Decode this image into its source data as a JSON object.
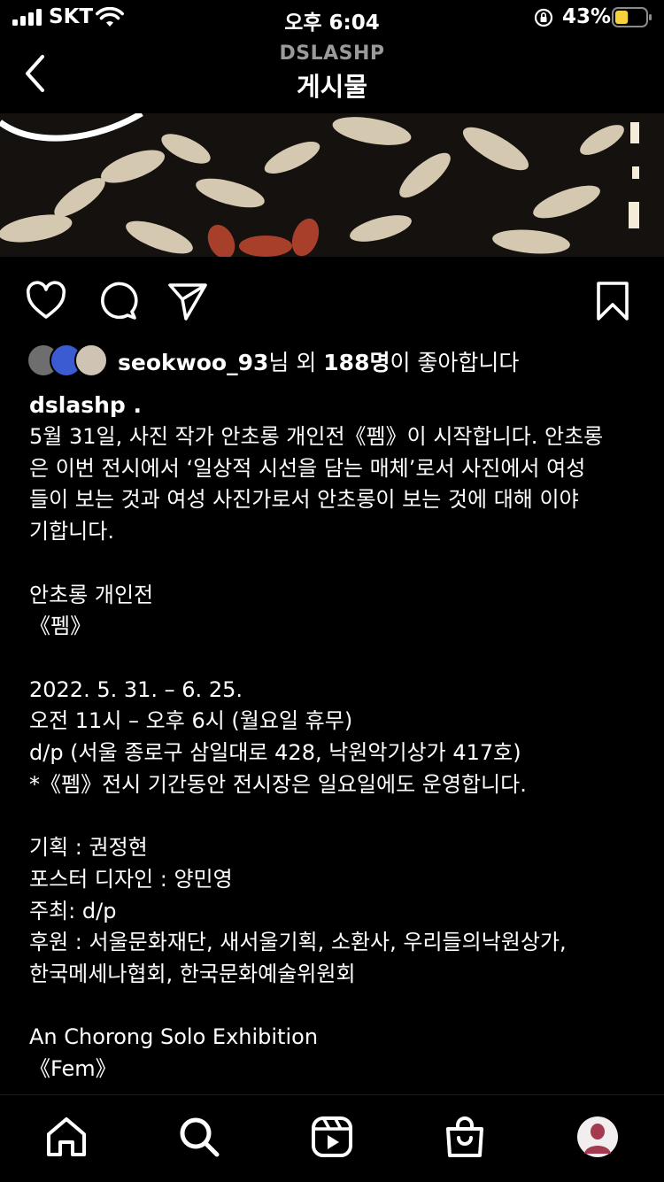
{
  "status_bar": {
    "carrier": "SKT",
    "time": "오후 6:04",
    "battery_percent": "43%",
    "battery_level": 0.43,
    "battery_color": "#F7D13B"
  },
  "header": {
    "account": "DSLASHP",
    "title": "게시물",
    "back_icon": "chevron-left-icon"
  },
  "post": {
    "image_description_colors": [
      "#141210",
      "#E8DCC6",
      "#B8452F"
    ],
    "actions": {
      "like_icon": "heart-icon",
      "comment_icon": "comment-icon",
      "share_icon": "paper-plane-icon",
      "save_icon": "bookmark-icon"
    },
    "likes": {
      "user": "seokwoo_93",
      "connector": "님 외 ",
      "count": "188명",
      "suffix": "이 좋아합니다"
    },
    "author": "dslashp .",
    "caption_lines": [
      "5월 31일, 사진 작가 안초롱 개인전《펨》이 시작합니다. 안초롱",
      "은 이번 전시에서 ‘일상적 시선을 담는 매체’로서 사진에서 여성",
      "들이 보는 것과 여성 사진가로서 안초롱이 보는 것에 대해 이야",
      "기합니다.",
      "",
      "안초롱 개인전",
      "《펨》",
      "",
      "2022. 5. 31. – 6. 25.",
      "오전 11시 – 오후 6시 (월요일 휴무)",
      "d/p (서울 종로구 삼일대로 428, 낙원악기상가 417호)",
      "*《펨》전시 기간동안 전시장은 일요일에도 운영합니다.",
      "",
      "기획 : 권정현",
      "포스터 디자인 : 양민영",
      "주최: d/p",
      "후원 : 서울문화재단, 새서울기획, 소환사, 우리들의낙원상가,",
      "한국메세나협회, 한국문화예술위원회",
      "",
      "An Chorong Solo Exhibition",
      "《Fem》"
    ]
  },
  "tab_bar": {
    "tabs": [
      {
        "icon": "home-icon"
      },
      {
        "icon": "search-icon"
      },
      {
        "icon": "reels-icon"
      },
      {
        "icon": "shop-icon"
      },
      {
        "icon": "profile-avatar-icon"
      }
    ]
  }
}
